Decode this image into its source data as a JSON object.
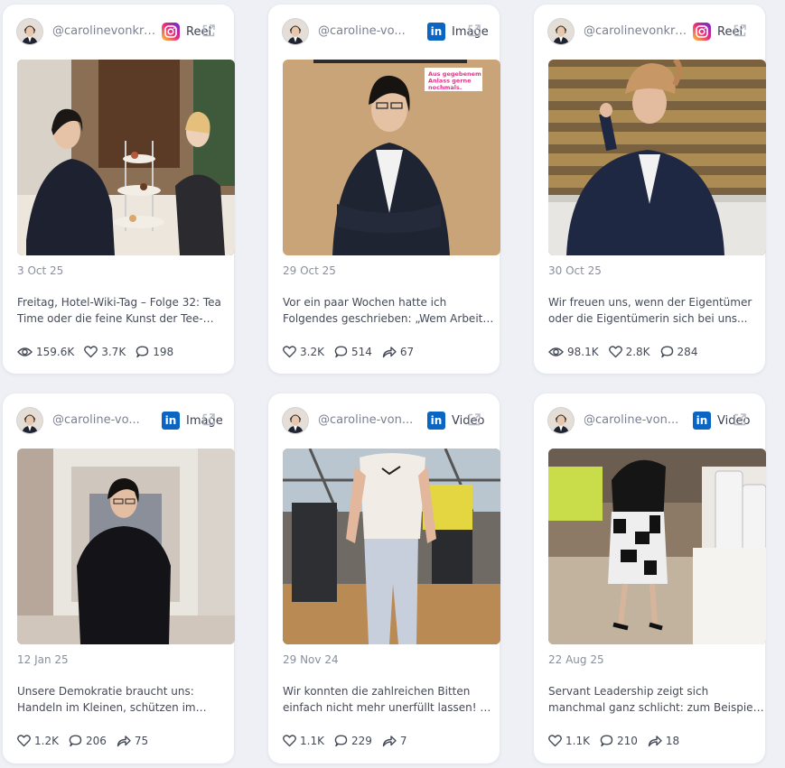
{
  "posts": [
    {
      "handle": "@carolinevonkre...",
      "platform": "Reel",
      "platform_icon": "instagram-icon",
      "date": "3 Oct 25",
      "text": "Freitag, Hotel-Wiki-Tag – Folge 32: Tea Time oder die feine Kunst der Tee-Etikett...",
      "views": "159.6K",
      "likes": "3.7K",
      "comments": "198"
    },
    {
      "handle": "@caroline-vo...",
      "platform": "Image",
      "platform_icon": "linkedin-icon",
      "date": "29 Oct 25",
      "text": "Vor ein paar Wochen hatte ich Folgendes geschrieben: „Wem Arbeit grundsätzlich...",
      "image_text": "Aus gegebenem Anlass gerne nochmals.",
      "likes": "3.2K",
      "comments": "514",
      "shares": "67"
    },
    {
      "handle": "@carolinevonkre...",
      "platform": "Reel",
      "platform_icon": "instagram-icon",
      "date": "30 Oct 25",
      "text": "Wir freuen uns, wenn der Eigentümer oder die Eigentümerin sich bei uns...",
      "views": "98.1K",
      "likes": "2.8K",
      "comments": "284"
    },
    {
      "handle": "@caroline-vo...",
      "platform": "Image",
      "platform_icon": "linkedin-icon",
      "date": "12 Jan 25",
      "text": "Unsere Demokratie braucht uns: Handeln im Kleinen, schützen im Großen – ein...",
      "likes": "1.2K",
      "comments": "206",
      "shares": "75"
    },
    {
      "handle": "@caroline-von...",
      "platform": "Video",
      "platform_icon": "linkedin-icon",
      "date": "29 Nov 24",
      "text": "Wir konnten die zahlreichen Bitten einfach nicht mehr unerfüllt lassen! 😉 ...",
      "likes": "1.1K",
      "comments": "229",
      "shares": "7"
    },
    {
      "handle": "@caroline-von...",
      "platform": "Video",
      "platform_icon": "linkedin-icon",
      "date": "22 Aug 25",
      "text": "Servant Leadership zeigt sich manchmal ganz schlicht: zum Beispiel beim...",
      "likes": "1.1K",
      "comments": "210",
      "shares": "18"
    }
  ],
  "colors": {
    "background": "#eef0f5",
    "card": "#ffffff",
    "linkedin": "#0a66c2",
    "muted_text": "#8a8f9c"
  }
}
